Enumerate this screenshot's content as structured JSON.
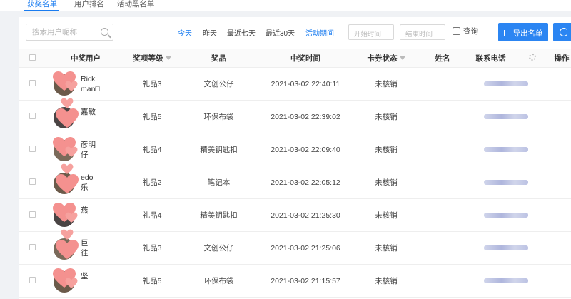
{
  "tabs": {
    "winners": "获奖名单",
    "ranking": "用户排名",
    "blacklist": "活动黑名单"
  },
  "toolbar": {
    "search_placeholder": "搜索用户昵称",
    "filters": [
      "今天",
      "昨天",
      "最近七天",
      "最近30天",
      "活动期间"
    ],
    "start_date_placeholder": "开始时间",
    "end_date_placeholder": "结束时间",
    "query_label": "查询",
    "export_label": "导出名单",
    "accent_color": "#1a7cf0"
  },
  "table": {
    "headers": [
      "中奖用户",
      "奖项等级",
      "奖品",
      "中奖时间",
      "卡券状态",
      "姓名",
      "联系电话",
      "操作"
    ],
    "rows": [
      {
        "user": "Rick\nman□",
        "level": "礼品3",
        "prize": "文创公仔",
        "time": "2021-03-02 22:40:11",
        "status": "未核销",
        "name": ""
      },
      {
        "user": "嘉敏",
        "level": "礼品5",
        "prize": "环保布袋",
        "time": "2021-03-02 22:39:02",
        "status": "未核销",
        "name": ""
      },
      {
        "user": "彦明\n仔",
        "level": "礼品4",
        "prize": "精美钥匙扣",
        "time": "2021-03-02 22:09:40",
        "status": "未核销",
        "name": ""
      },
      {
        "user": "edo\n乐",
        "level": "礼品2",
        "prize": "笔记本",
        "time": "2021-03-02 22:05:12",
        "status": "未核销",
        "name": ""
      },
      {
        "user": "燕",
        "level": "礼品4",
        "prize": "精美钥匙扣",
        "time": "2021-03-02 21:25:30",
        "status": "未核销",
        "name": ""
      },
      {
        "user": "巨\n往",
        "level": "礼品3",
        "prize": "文创公仔",
        "time": "2021-03-02 21:25:06",
        "status": "未核销",
        "name": ""
      },
      {
        "user": "坚",
        "level": "礼品5",
        "prize": "环保布袋",
        "time": "2021-03-02 21:15:57",
        "status": "未核销",
        "name": ""
      }
    ]
  }
}
